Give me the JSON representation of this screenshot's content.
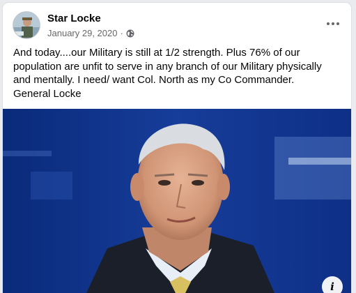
{
  "post": {
    "author": "Star Locke",
    "date": "January 29, 2020",
    "separator": "·",
    "privacy_icon": "globe-icon",
    "more_icon": "more-options-icon",
    "text": "And today....our Military is still at 1/2 strength.  Plus  76% of our\npopulation are unfit to serve in any branch of our Military physically\nand mentally.       I need/ want Col. North as my Co Commander.\nGeneral Locke"
  },
  "photo": {
    "info_icon": "info-icon",
    "info_label": "i"
  }
}
